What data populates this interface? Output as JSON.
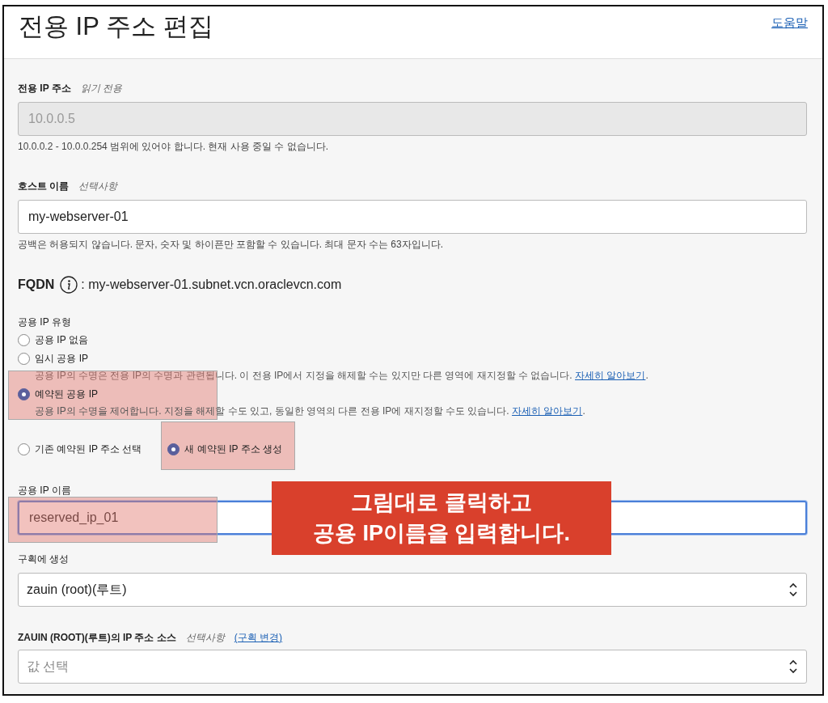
{
  "header": {
    "title": "전용 IP 주소 편집",
    "help_link": "도움말"
  },
  "private_ip": {
    "label": "전용 IP 주소",
    "hint": "읽기 전용",
    "value": "10.0.0.5",
    "disabled": true,
    "help": "10.0.0.2 - 10.0.0.254 범위에 있어야 합니다. 현재 사용 중일 수 없습니다."
  },
  "hostname": {
    "label": "호스트 이름",
    "hint": "선택사항",
    "value": "my-webserver-01",
    "help": "공백은 허용되지 않습니다. 문자, 숫자 및 하이픈만 포함할 수 있습니다. 최대 문자 수는 63자입니다."
  },
  "fqdn": {
    "label": "FQDN",
    "value": ": my-webserver-01.subnet.vcn.oraclevcn.com"
  },
  "public_ip_type": {
    "label": "공용 IP 유형",
    "options": [
      {
        "label": "공용 IP 없음",
        "selected": false
      },
      {
        "label": "임시 공용 IP",
        "selected": false,
        "description": "공용 IP의 수명은 전용 IP의 수명과 관련됩니다. 이 전용 IP에서 지정을 해제할 수는 있지만 다른 영역에 재지정할 수 없습니다.",
        "link": "자세히 알아보기",
        "link_suffix": "."
      },
      {
        "label": "예약된 공용 IP",
        "selected": true,
        "highlighted": true,
        "description": "공용 IP의 수명을 제어합니다. 지정을 해제할 수도 있고, 동일한 영역의 다른 전용 IP에 재지정할 수도 있습니다.",
        "link": "자세히 알아보기",
        "link_suffix": "."
      }
    ]
  },
  "reserved_source": {
    "options": [
      {
        "label": "기존 예약된 IP 주소 선택",
        "selected": false
      },
      {
        "label": "새 예약된 IP 주소 생성",
        "selected": true,
        "highlighted": true
      }
    ]
  },
  "public_ip_name": {
    "label": "공용 IP 이름",
    "value": "reserved_ip_01",
    "focused": true,
    "highlighted": true
  },
  "compartment": {
    "label": "구획에 생성",
    "value": "zauin (root)(루트)"
  },
  "ip_source": {
    "label": "ZAUIN (ROOT)(루트)의 IP 주소 소스",
    "hint": "선택사항",
    "link": "(구획 변경)",
    "placeholder": "값 선택"
  },
  "annotation": {
    "lines": [
      "그림대로 클릭하고",
      "공용 IP이름을 입력합니다."
    ]
  }
}
